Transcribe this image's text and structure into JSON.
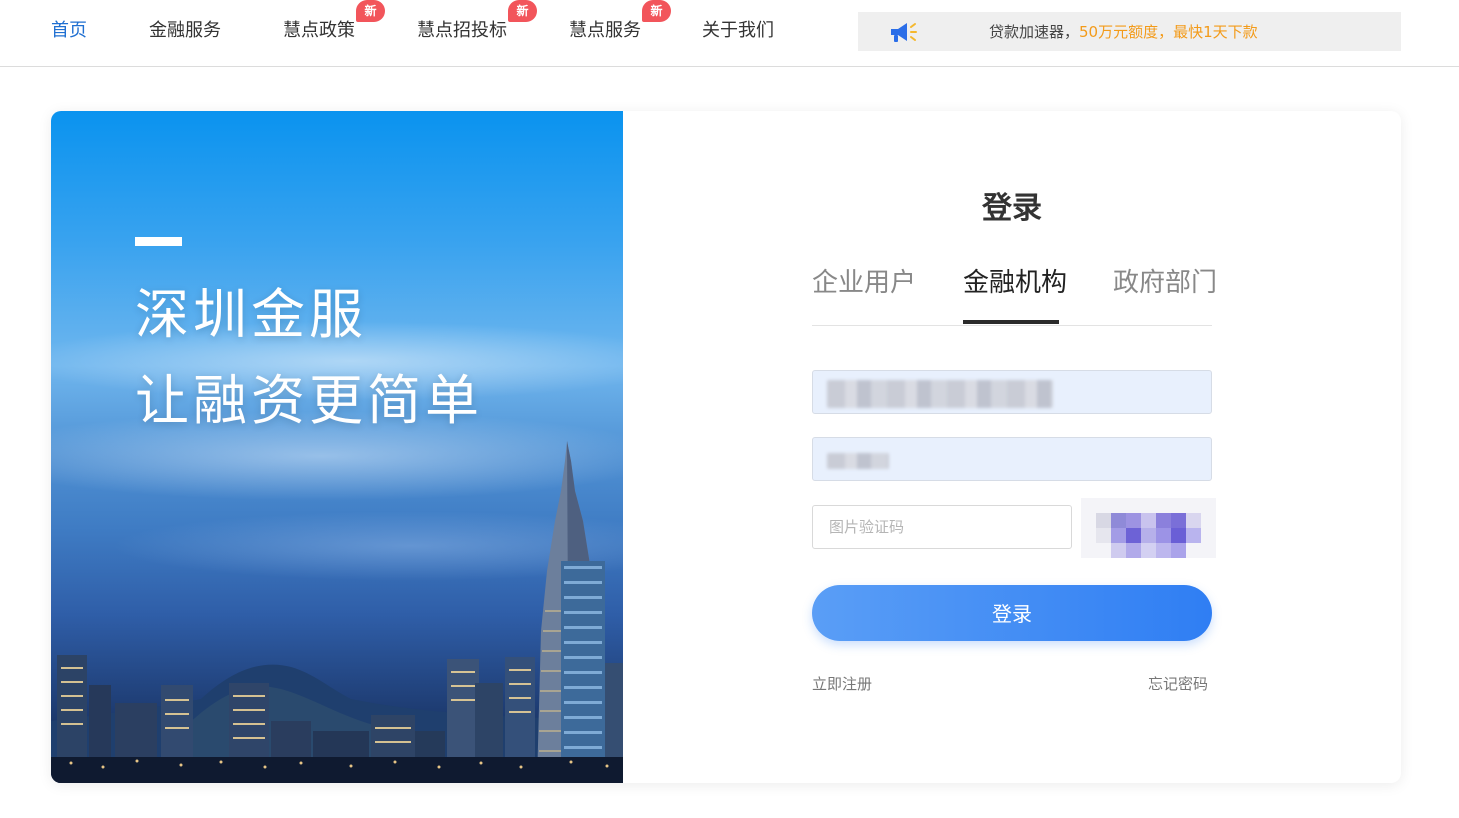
{
  "nav": {
    "items": [
      {
        "label": "首页",
        "active": true
      },
      {
        "label": "金融服务"
      },
      {
        "label": "慧点政策",
        "badge": "新"
      },
      {
        "label": "慧点招投标",
        "badge": "新"
      },
      {
        "label": "慧点服务",
        "badge": "新"
      },
      {
        "label": "关于我们"
      }
    ],
    "notice": {
      "text_prefix": "贷款加速器，",
      "text_highlight": "50万元额度，最快1天下款",
      "icon": "megaphone-icon"
    }
  },
  "banner": {
    "line1": "深圳金服",
    "line2": "让融资更简单"
  },
  "login": {
    "title": "登录",
    "tabs": [
      {
        "label": "企业用户"
      },
      {
        "label": "金融机构",
        "active": true
      },
      {
        "label": "政府部门"
      }
    ],
    "captcha_placeholder": "图片验证码",
    "submit_label": "登录",
    "register_label": "立即注册",
    "forgot_label": "忘记密码"
  },
  "colors": {
    "accent": "#1f6fd1",
    "badge": "#f2555b",
    "highlight": "#f39b1a",
    "button_start": "#5a9ef6",
    "button_end": "#2f7ef3"
  }
}
